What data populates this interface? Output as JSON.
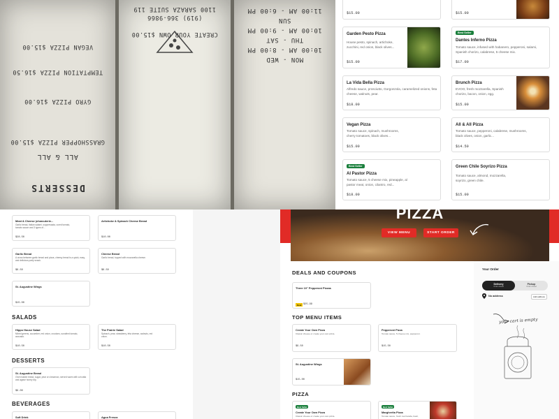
{
  "paper_menu": {
    "left_page": [
      "DESSERTS",
      "ALL & ALL",
      "GRASSHOPPER PIZZA $15.00",
      "GYRO PIZZA $16.00",
      "TEMPTATION PIZZA $16.50",
      "VEGAN PIZZA $15.00"
    ],
    "middle_page": [
      "CREATE YOUR OWN $15.00",
      "(919) 366-9866",
      "1100 SARAZA SUITE 119"
    ],
    "hours": [
      "MON - WED",
      "10:00 AM - 8:00 PM",
      "THU - SAT",
      "10:00 AM - 9:00 PM",
      "SUN",
      "11:00 AM - 6:00 PM"
    ]
  },
  "top_cards": [
    {
      "name": "",
      "desc": "",
      "price": "$15.00"
    },
    {
      "name": "",
      "desc": "",
      "price": "$15.00"
    },
    {
      "name": "Garden Pesto Pizza",
      "desc": "House pesto, spinach, artichoke, zucchini, red onion, black olives...",
      "price": "$15.00",
      "badge": ""
    },
    {
      "name": "Dantes Inferno Pizza",
      "desc": "Tomato sauce, infused with habanero, pepperoni, salami, Spanish chorizo, calabrese, 5 cheese mix.",
      "price": "$17.00",
      "badge": "Best Seller"
    },
    {
      "name": "La Vida Bella Pizza",
      "desc": "Alfredo sauce, prosciutto, Gorgonzola, caramelized onions, feta cheese, walnuts, pear.",
      "price": "$18.00"
    },
    {
      "name": "Brunch Pizza",
      "desc": "EVOO, fresh mozzarella, Spanish chorizo, bacon, onion, egg.",
      "price": "$15.00"
    },
    {
      "name": "Vegan Pizza",
      "desc": "Tomato sauce, spinach, mushrooms, cherry tomatoes, black olives...",
      "price": "$15.00"
    },
    {
      "name": "All & All Pizza",
      "desc": "Tomato sauce, pepperoni, calabrese, mushrooms, black olives, onion, garlic...",
      "price": "$14.50"
    },
    {
      "name": "Al Pastor Pizza",
      "desc": "Tomato sauce, 5 cheese mix, pineapple, al pastor meat, onion, cilantro, red...",
      "price": "$18.00",
      "badge": "Best Seller"
    },
    {
      "name": "Green Chile Soyrizo Pizza",
      "desc": "Tomato sauce, almond, mozzarella, soyrizo, green chile.",
      "price": "$15.00"
    }
  ],
  "left_menu": {
    "cards": [
      {
        "name": "Meat & Cheese (charcuterie...",
        "desc": "Garlic bread, Italian salami, soppressata, cured tomato, tomato sauce and 3 types of...",
        "price": "$28.50"
      },
      {
        "name": "Artichoke & Spinach Cheese Bread",
        "desc": "",
        "price": "$10.00"
      },
      {
        "name": "Garlic Bread",
        "desc": "A cross between garlic bread and pizza, cheesy bread is a quick, easy, and delicious party snack.",
        "price": "$6.50"
      },
      {
        "name": "Cheese Bread",
        "desc": "Garlic bread, topped with mozzarella cheese.",
        "price": "$6.50"
      },
      {
        "name": "St. Augustine Wings",
        "desc": "",
        "price": "$15.00"
      }
    ],
    "section_salads": "SALADS",
    "salads": [
      {
        "name": "Hippo House Salad",
        "desc": "Mixed greens, cucumber, red onion, croutons, sundried tomato, avocado.",
        "price": "$10.50"
      },
      {
        "name": "The Prairie Salad",
        "desc": "Spinach, pear, strawberry, feta cheese, walnuts, red onion.",
        "price": "$10.50"
      }
    ],
    "section_desserts": "DESSERTS",
    "desserts": [
      {
        "name": "St. Augustine Bread",
        "desc": "Oven baked bread, sugar, pear or cinnamon, served warm with a ricotta and agave honey dip.",
        "price": "$9.00"
      }
    ],
    "section_beverages": "BEVERAGES",
    "beverages": [
      {
        "name": "Soft Drink"
      },
      {
        "name": "Agua Fresca"
      }
    ]
  },
  "site": {
    "hero_title": "PIZZA",
    "view_menu": "VIEW MENU",
    "start_order": "START ORDER",
    "deals_title": "DEALS AND COUPONS",
    "deal": {
      "name": "Three 10\" Pepperoni Pizzas",
      "badge": "Deal",
      "price": "$25.99"
    },
    "top_items_title": "TOP MENU ITEMS",
    "top_items": [
      {
        "name": "Create Your Own Pizza",
        "desc": "Classic cheese or create your own pizza.",
        "price": "$9.50"
      },
      {
        "name": "Pepperoni Pizza",
        "desc": "Tomato sauce, 5 cheese mix, pepperoni.",
        "price": "$15.50"
      },
      {
        "name": "St. Augustine Wings",
        "desc": "",
        "price": "$15.00"
      }
    ],
    "pizza_title": "PIZZA",
    "pizza_items": [
      {
        "name": "Create Your Own Pizza",
        "desc": "Classic cheese or create your own pizza.",
        "badge": "Best Seller"
      },
      {
        "name": "Margherita Pizza",
        "desc": "Tomato sauce, fresh mozzarella, basil,",
        "badge": "Best Seller"
      }
    ],
    "order": {
      "title": "Your Order",
      "delivery": "Delivery",
      "delivery_sub": "Order ahead",
      "pickup": "Pickup",
      "pickup_sub": "Order ahead",
      "address": "No address",
      "add_address": "Add address",
      "empty": "your cart is empty"
    }
  },
  "colors": {
    "brand_red": "#e12b26",
    "badge_green": "#1a7f3c",
    "toggle_dark": "#222222"
  }
}
